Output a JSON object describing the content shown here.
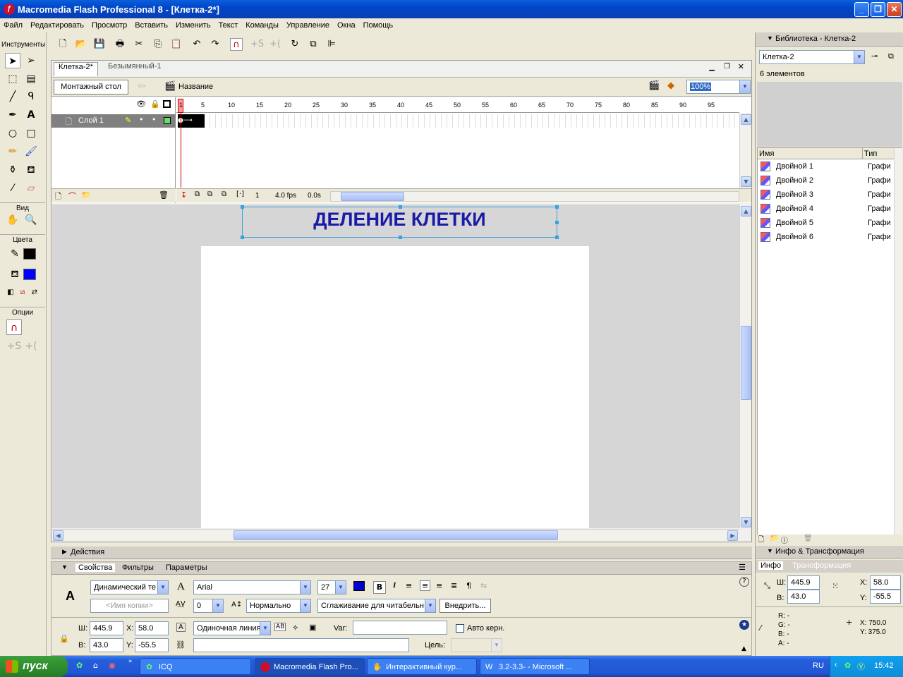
{
  "window": {
    "title": "Macromedia Flash Professional 8 - [Клетка-2*]"
  },
  "menu": [
    "Файл",
    "Редактировать",
    "Просмотр",
    "Вставить",
    "Изменить",
    "Текст",
    "Команды",
    "Управление",
    "Окна",
    "Помощь"
  ],
  "toolbox": {
    "title": "Инструменты",
    "view_label": "Вид",
    "colors_label": "Цвета",
    "options_label": "Опции",
    "stroke_color": "#000000",
    "fill_color": "#0000ff"
  },
  "document": {
    "tabs": [
      "Клетка-2*",
      "Безымянный-1"
    ],
    "scene_button": "Монтажный стол",
    "scene_name": "Название",
    "zoom": "100%",
    "layer_name": "Слой 1",
    "frame_numbers": [
      "1",
      "5",
      "10",
      "15",
      "20",
      "25",
      "30",
      "35",
      "40",
      "45",
      "50",
      "55",
      "60",
      "65",
      "70",
      "75",
      "80",
      "85",
      "90",
      "95"
    ],
    "current_frame": "1",
    "fps": "4.0 fps",
    "time": "0.0s",
    "stage_text": "ДЕЛЕНИЕ КЛЕТКИ",
    "stage_text_color": "#1a1aa8"
  },
  "actions_panel": {
    "title": "Действия"
  },
  "properties": {
    "tabs": [
      "Свойства",
      "Фильтры",
      "Параметры"
    ],
    "text_type": "Динамический те",
    "instance_name_placeholder": "<Имя копии>",
    "font": "Arial",
    "font_size": "27",
    "letter_spacing": "0",
    "baseline": "Нормально",
    "anti_alias": "Сглаживание для читабельн",
    "embed_button": "Внедрить...",
    "w_label": "Ш:",
    "w": "445.9",
    "h_label": "В:",
    "h": "43.0",
    "x_label": "X:",
    "x": "58.0",
    "y_label": "Y:",
    "y": "-55.5",
    "line_type": "Одиночная линия",
    "var_label": "Var:",
    "var_value": "",
    "auto_kern": "Авто керн.",
    "target_label": "Цель:",
    "text_color": "#0000cc"
  },
  "library": {
    "title": "Библиотека - Клетка-2",
    "selected_doc": "Клетка-2",
    "count": "6 элементов",
    "col_name": "Имя",
    "col_type": "Тип",
    "items": [
      {
        "name": "Двойной 1",
        "type": "Графи"
      },
      {
        "name": "Двойной 2",
        "type": "Графи"
      },
      {
        "name": "Двойной 3",
        "type": "Графи"
      },
      {
        "name": "Двойной 4",
        "type": "Графи"
      },
      {
        "name": "Двойной 5",
        "type": "Графи"
      },
      {
        "name": "Двойной 6",
        "type": "Графи"
      }
    ]
  },
  "info_panel": {
    "title": "Инфо & Трансформация",
    "tabs": [
      "Инфо",
      "Трансформация"
    ],
    "w_label": "Ш:",
    "w": "445.9",
    "h_label": "В:",
    "h": "43.0",
    "x_label": "X:",
    "x": "58.0",
    "y_label": "Y:",
    "y": "-55.5",
    "r": "R: -",
    "g": "G: -",
    "b": "B: -",
    "a": "A: -",
    "cursor_x": "X:  750.0",
    "cursor_y": "Y:  375.0"
  },
  "taskbar": {
    "start": "пуск",
    "items": [
      "ICQ",
      "Macromedia Flash Pro...",
      "Интерактивный кур...",
      "3.2-3.3- - Microsoft ..."
    ],
    "lang": "RU",
    "clock": "15:42"
  }
}
